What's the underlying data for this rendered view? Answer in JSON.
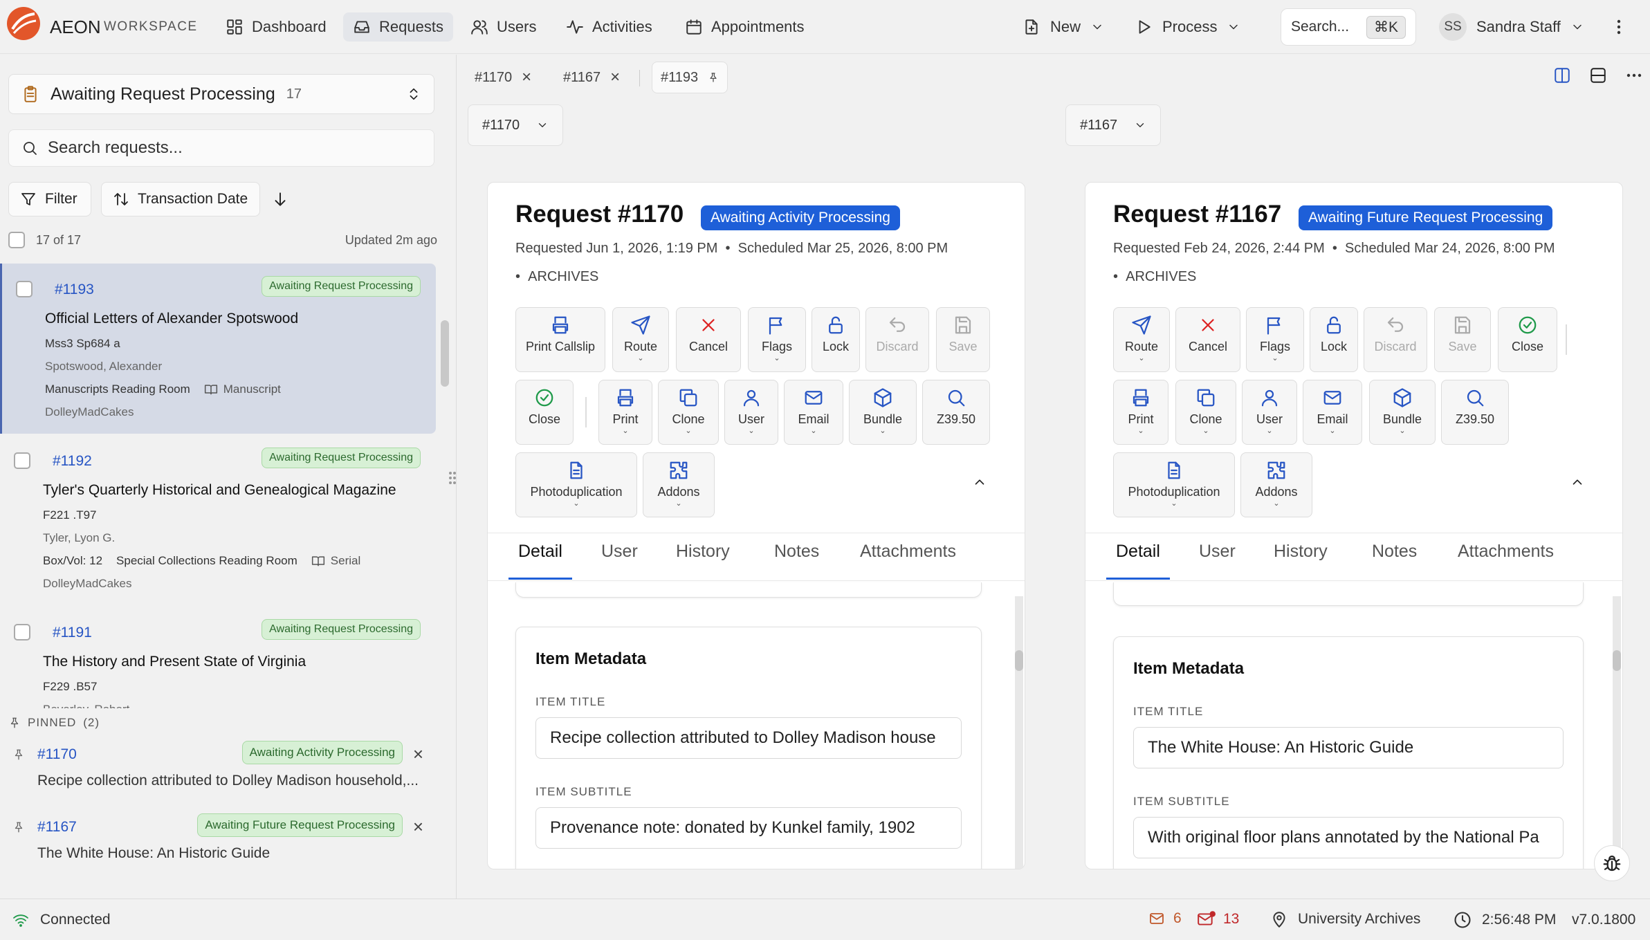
{
  "app": {
    "brand": "AEON",
    "brand_sub": "WORKSPACE",
    "version": "v7.0.1800"
  },
  "nav": [
    {
      "label": "Dashboard",
      "icon": "dashboard-icon"
    },
    {
      "label": "Requests",
      "icon": "inbox-icon",
      "active": true
    },
    {
      "label": "Users",
      "icon": "users-icon"
    },
    {
      "label": "Activities",
      "icon": "activity-icon"
    },
    {
      "label": "Appointments",
      "icon": "calendar-icon"
    }
  ],
  "header": {
    "new_label": "New",
    "process_label": "Process",
    "search_label": "Search...",
    "search_shortcut": "⌘K",
    "user_initials": "SS",
    "user_name": "Sandra Staff"
  },
  "queue": {
    "title": "Awaiting Request Processing",
    "count": "17",
    "search_placeholder": "Search requests...",
    "filter_label": "Filter",
    "sort_label": "Transaction Date",
    "selected_count": "17 of 17",
    "updated": "Updated 2m ago"
  },
  "requests": [
    {
      "id": "#1193",
      "status": "Awaiting Request Processing",
      "title": "Official Letters of Alexander Spotswood",
      "callnum": "Mss3 Sp684 a",
      "author": "Spotswood, Alexander",
      "location": "Manuscripts Reading Room",
      "format": "Manuscript",
      "user": "DolleyMadCakes"
    },
    {
      "id": "#1192",
      "status": "Awaiting Request Processing",
      "title": "Tyler's Quarterly Historical and Genealogical Magazine",
      "callnum": "F221 .T97",
      "author": "Tyler, Lyon G.",
      "boxvol_label": "Box/Vol:",
      "boxvol": "12",
      "location": "Special Collections Reading Room",
      "format": "Serial",
      "user": "DolleyMadCakes"
    },
    {
      "id": "#1191",
      "status": "Awaiting Request Processing",
      "title": "The History and Present State of Virginia",
      "callnum": "F229 .B57",
      "author": "Beverley, Robert"
    }
  ],
  "pinned": {
    "label": "PINNED",
    "count": "(2)",
    "items": [
      {
        "id": "#1170",
        "status": "Awaiting Activity Processing",
        "title": "Recipe collection attributed to Dolley Madison household,..."
      },
      {
        "id": "#1167",
        "status": "Awaiting Future Request Processing",
        "title": "The White House: An Historic Guide"
      }
    ]
  },
  "tabs": [
    "#1170",
    "#1167",
    "#1193"
  ],
  "pane_left": {
    "selector": "#1170",
    "title": "Request #1170",
    "status": "Awaiting Activity Processing",
    "requested": "Requested Jun 1, 2026, 1:19 PM",
    "scheduled": "Scheduled Mar 25, 2026, 8:00 PM",
    "site": "ARCHIVES",
    "actions": [
      "Print Callslip",
      "Route",
      "Cancel",
      "Flags",
      "Lock",
      "Discard",
      "Save",
      "Close",
      "Print",
      "Clone",
      "User",
      "Email",
      "Bundle",
      "Z39.50",
      "Photoduplication",
      "Addons"
    ],
    "tabs": [
      "Detail",
      "User",
      "History",
      "Notes",
      "Attachments"
    ],
    "section": "Item Metadata",
    "item_title_label": "ITEM TITLE",
    "item_title": "Recipe collection attributed to Dolley Madison house",
    "item_subtitle_label": "ITEM SUBTITLE",
    "item_subtitle": "Provenance note: donated by Kunkel family, 1902"
  },
  "pane_right": {
    "selector": "#1167",
    "title": "Request #1167",
    "status": "Awaiting Future Request Processing",
    "requested": "Requested Feb 24, 2026, 2:44 PM",
    "scheduled": "Scheduled Mar 24, 2026, 8:00 PM",
    "site": "ARCHIVES",
    "actions": [
      "Route",
      "Cancel",
      "Flags",
      "Lock",
      "Discard",
      "Save",
      "Close",
      "Print",
      "Clone",
      "User",
      "Email",
      "Bundle",
      "Z39.50",
      "Photoduplication",
      "Addons"
    ],
    "tabs": [
      "Detail",
      "User",
      "History",
      "Notes",
      "Attachments"
    ],
    "section": "Item Metadata",
    "item_title_label": "ITEM TITLE",
    "item_title": "The White House: An Historic Guide",
    "item_subtitle_label": "ITEM SUBTITLE",
    "item_subtitle": "With original floor plans annotated by the National Pa"
  },
  "footer": {
    "connection": "Connected",
    "mail_count": "6",
    "alert_mail_count": "13",
    "location": "University Archives",
    "time": "2:56:48 PM"
  },
  "colors": {
    "accent": "#1e5fd8",
    "badge_green_bg": "#d7f0d5",
    "link": "#2755c4",
    "logo": "#e2562a"
  }
}
